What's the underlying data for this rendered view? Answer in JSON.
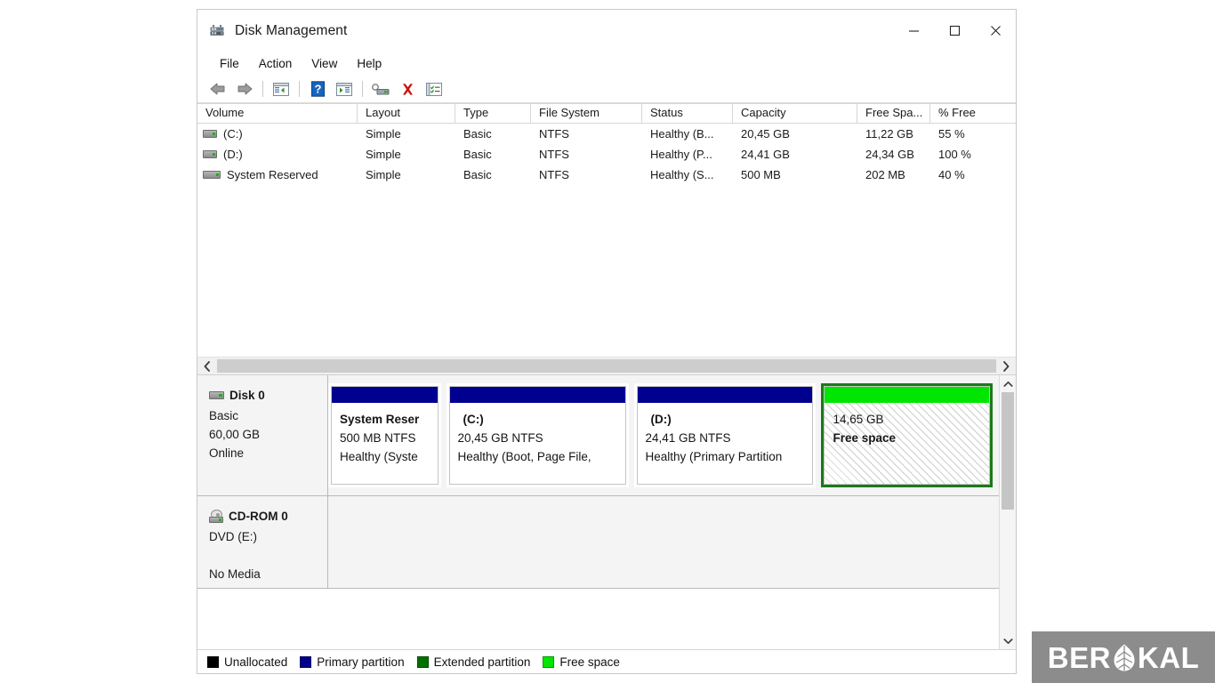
{
  "window": {
    "title": "Disk Management",
    "icon": "disk-management-icon",
    "controls": {
      "minimize": "minimize-icon",
      "maximize": "maximize-icon",
      "close": "close-icon"
    }
  },
  "menubar": {
    "items": [
      {
        "label": "File"
      },
      {
        "label": "Action"
      },
      {
        "label": "View"
      },
      {
        "label": "Help"
      }
    ]
  },
  "toolbar": {
    "buttons": [
      {
        "name": "back-icon",
        "title": "Back"
      },
      {
        "name": "forward-icon",
        "title": "Forward"
      },
      {
        "name": "show-hide-console-tree-icon",
        "title": "Show/Hide Console Tree"
      },
      {
        "name": "help-icon",
        "title": "Help"
      },
      {
        "name": "show-hide-action-pane-icon",
        "title": "Show/Hide Action Pane"
      },
      {
        "name": "rescan-disks-icon",
        "title": "Rescan Disks"
      },
      {
        "name": "delete-volume-icon",
        "title": "Delete Volume"
      },
      {
        "name": "properties-icon",
        "title": "Properties"
      }
    ]
  },
  "volume_list": {
    "columns": [
      {
        "label": "Volume",
        "width": 180
      },
      {
        "label": "Layout",
        "width": 110
      },
      {
        "label": "Type",
        "width": 85
      },
      {
        "label": "File System",
        "width": 125
      },
      {
        "label": "Status",
        "width": 102
      },
      {
        "label": "Capacity",
        "width": 140
      },
      {
        "label": "Free Spa...",
        "width": 82
      },
      {
        "label": "% Free",
        "width": 80
      }
    ],
    "rows": [
      {
        "icon": "volume-drive-icon",
        "volume": "(C:)",
        "layout": "Simple",
        "type": "Basic",
        "file_system": "NTFS",
        "status": "Healthy (B...",
        "capacity": "20,45 GB",
        "free_space": "11,22 GB",
        "percent_free": "55 %"
      },
      {
        "icon": "volume-drive-icon",
        "volume": "(D:)",
        "layout": "Simple",
        "type": "Basic",
        "file_system": "NTFS",
        "status": "Healthy (P...",
        "capacity": "24,41 GB",
        "free_space": "24,34 GB",
        "percent_free": "100 %"
      },
      {
        "icon": "volume-drive-icon",
        "volume": "System Reserved",
        "layout": "Simple",
        "type": "Basic",
        "file_system": "NTFS",
        "status": "Healthy (S...",
        "capacity": "500 MB",
        "free_space": "202 MB",
        "percent_free": "40 %"
      }
    ]
  },
  "disks": [
    {
      "name": "Disk 0",
      "icon": "disk-icon",
      "type": "Basic",
      "size": "60,00 GB",
      "state": "Online",
      "partitions": [
        {
          "name": "system-reserved-partition",
          "label": "System Reser",
          "size_fs": "500 MB NTFS",
          "status": "Healthy (Syste",
          "bar_color": "#00008f",
          "selected": false,
          "hatched": false,
          "flex": 126
        },
        {
          "name": "c-partition",
          "label": "(C:)",
          "size_fs": "20,45 GB NTFS",
          "status": "Healthy (Boot, Page File,",
          "bar_color": "#00008f",
          "selected": false,
          "hatched": false,
          "flex": 208
        },
        {
          "name": "d-partition",
          "label": "(D:)",
          "size_fs": "24,41 GB NTFS",
          "status": "Healthy (Primary Partition",
          "bar_color": "#00008f",
          "selected": false,
          "hatched": false,
          "flex": 208
        },
        {
          "name": "free-space-partition",
          "label": "",
          "size_fs": "14,65 GB",
          "status": "Free space",
          "bar_color": "#00e600",
          "selected": true,
          "hatched": true,
          "flex": 195
        }
      ]
    },
    {
      "name": "CD-ROM 0",
      "icon": "cdrom-icon",
      "type": "DVD (E:)",
      "size": "",
      "state": "No Media",
      "partitions": []
    }
  ],
  "legend": {
    "items": [
      {
        "label": "Unallocated",
        "color": "#000000"
      },
      {
        "label": "Primary partition",
        "color": "#00008f"
      },
      {
        "label": "Extended partition",
        "color": "#007000"
      },
      {
        "label": "Free space",
        "color": "#00e600"
      }
    ]
  },
  "scrollbars": {
    "horizontal_left_arrow": "chevron-left-icon",
    "horizontal_right_arrow": "chevron-right-icon",
    "vertical_up_arrow": "chevron-up-icon",
    "vertical_down_arrow": "chevron-down-icon"
  },
  "watermark": {
    "text_before": "BER",
    "text_after": "KAL",
    "logo": "leaf-logo-icon"
  }
}
